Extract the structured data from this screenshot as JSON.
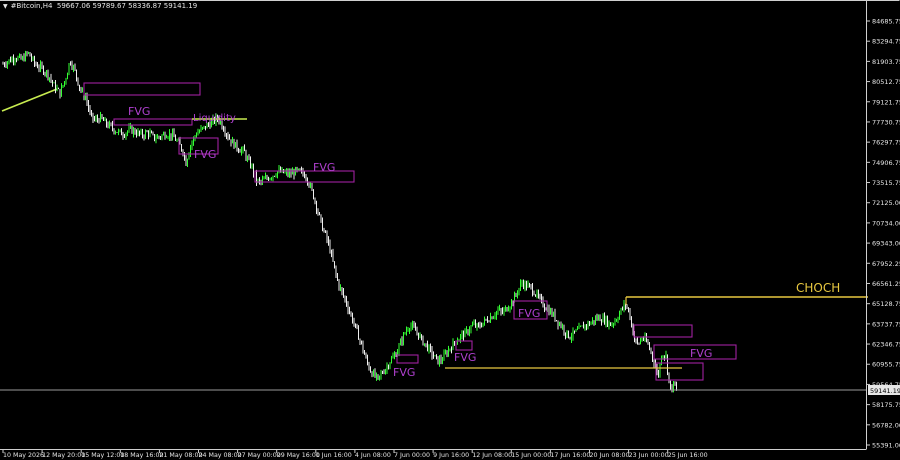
{
  "window": {
    "symbol": "#Bitcoin,H4",
    "ohlc": "59667.06 59789.67 58336.87 59141.19"
  },
  "colors": {
    "background": "#000000",
    "bull_candle": "#33ff33",
    "bear_candle": "#f0f0f0",
    "fvg_box": "#a020a0",
    "fvg_text": "#b040d0",
    "choch": "#e8c840",
    "liquidity": "#c8ec50",
    "trendline": "#c8ec50",
    "bid_line": "#9a9a9a",
    "axis_text": "#e6e6e6"
  },
  "chart_data": {
    "type": "candlestick",
    "price_axis": {
      "ticks": [
        "84685.75",
        "83294.75",
        "81903.75",
        "80512.75",
        "79121.75",
        "77730.75",
        "76297.75",
        "74906.75",
        "73515.75",
        "72125.00",
        "70734.00",
        "69343.00",
        "67952.25",
        "66561.25",
        "65128.75",
        "63737.75",
        "62346.75",
        "60955.75",
        "59564.75",
        "58175.75",
        "56782.00",
        "55391.00"
      ],
      "current_price": "59141.19"
    },
    "time_axis": {
      "ticks": [
        "10 May 2026",
        "12 May 20:00",
        "15 May 12:00",
        "18 May 16:00",
        "21 May 08:00",
        "24 May 08:00",
        "27 May 00:00",
        "29 May 16:00",
        "1 Jun 16:00",
        "4 Jun 08:00",
        "7 Jun 00:00",
        "9 Jun 16:00",
        "12 Jun 08:00",
        "15 Jun 00:00",
        "17 Jun 16:00",
        "20 Jun 08:00",
        "23 Jun 00:00",
        "25 Jun 16:00"
      ]
    },
    "close_path": [
      [
        0,
        81600
      ],
      [
        8,
        81900
      ],
      [
        15,
        82200
      ],
      [
        22,
        82000
      ],
      [
        28,
        82500
      ],
      [
        35,
        81700
      ],
      [
        42,
        81400
      ],
      [
        48,
        81000
      ],
      [
        54,
        80200
      ],
      [
        60,
        79700
      ],
      [
        66,
        80800
      ],
      [
        70,
        82000
      ],
      [
        75,
        81200
      ],
      [
        80,
        80000
      ],
      [
        86,
        79400
      ],
      [
        90,
        78200
      ],
      [
        95,
        77800
      ],
      [
        100,
        78000
      ],
      [
        106,
        77600
      ],
      [
        112,
        77300
      ],
      [
        118,
        77000
      ],
      [
        124,
        76900
      ],
      [
        130,
        77200
      ],
      [
        136,
        77000
      ],
      [
        142,
        76800
      ],
      [
        148,
        77000
      ],
      [
        154,
        76600
      ],
      [
        160,
        76700
      ],
      [
        166,
        76900
      ],
      [
        172,
        76800
      ],
      [
        178,
        76300
      ],
      [
        183,
        75700
      ],
      [
        186,
        74900
      ],
      [
        190,
        76000
      ],
      [
        196,
        76900
      ],
      [
        202,
        77200
      ],
      [
        208,
        77500
      ],
      [
        214,
        77800
      ],
      [
        218,
        78000
      ],
      [
        222,
        77500
      ],
      [
        226,
        77000
      ],
      [
        230,
        76500
      ],
      [
        235,
        76100
      ],
      [
        240,
        75800
      ],
      [
        244,
        75700
      ],
      [
        248,
        75000
      ],
      [
        252,
        74600
      ],
      [
        256,
        73700
      ],
      [
        260,
        73500
      ],
      [
        266,
        73800
      ],
      [
        272,
        74000
      ],
      [
        278,
        74300
      ],
      [
        284,
        74200
      ],
      [
        290,
        74100
      ],
      [
        296,
        74300
      ],
      [
        302,
        74200
      ],
      [
        306,
        74000
      ],
      [
        310,
        73300
      ],
      [
        314,
        72500
      ],
      [
        318,
        71500
      ],
      [
        322,
        70500
      ],
      [
        326,
        69800
      ],
      [
        330,
        68900
      ],
      [
        334,
        67700
      ],
      [
        338,
        66600
      ],
      [
        342,
        65900
      ],
      [
        346,
        65300
      ],
      [
        350,
        64500
      ],
      [
        354,
        63800
      ],
      [
        358,
        63000
      ],
      [
        362,
        62200
      ],
      [
        366,
        61300
      ],
      [
        370,
        60600
      ],
      [
        374,
        60200
      ],
      [
        378,
        59900
      ],
      [
        382,
        60400
      ],
      [
        386,
        60700
      ],
      [
        390,
        61200
      ],
      [
        394,
        61500
      ],
      [
        398,
        62000
      ],
      [
        402,
        62700
      ],
      [
        406,
        63300
      ],
      [
        410,
        63700
      ],
      [
        414,
        63400
      ],
      [
        418,
        63100
      ],
      [
        422,
        62600
      ],
      [
        426,
        62300
      ],
      [
        430,
        61900
      ],
      [
        434,
        61500
      ],
      [
        438,
        61200
      ],
      [
        442,
        61300
      ],
      [
        446,
        61700
      ],
      [
        450,
        62100
      ],
      [
        454,
        62400
      ],
      [
        458,
        62700
      ],
      [
        462,
        63000
      ],
      [
        466,
        63100
      ],
      [
        470,
        63500
      ],
      [
        474,
        63700
      ],
      [
        478,
        63500
      ],
      [
        482,
        63800
      ],
      [
        486,
        64000
      ],
      [
        490,
        64200
      ],
      [
        494,
        64400
      ],
      [
        498,
        64700
      ],
      [
        502,
        64500
      ],
      [
        506,
        64800
      ],
      [
        510,
        65100
      ],
      [
        514,
        65500
      ],
      [
        518,
        66100
      ],
      [
        522,
        66600
      ],
      [
        526,
        66400
      ],
      [
        530,
        66300
      ],
      [
        534,
        66000
      ],
      [
        538,
        65600
      ],
      [
        542,
        65200
      ],
      [
        546,
        64900
      ],
      [
        550,
        64600
      ],
      [
        554,
        64300
      ],
      [
        558,
        63900
      ],
      [
        562,
        63600
      ],
      [
        566,
        63100
      ],
      [
        570,
        62900
      ],
      [
        574,
        63100
      ],
      [
        578,
        63300
      ],
      [
        582,
        63500
      ],
      [
        586,
        63700
      ],
      [
        590,
        63800
      ],
      [
        594,
        64000
      ],
      [
        598,
        64200
      ],
      [
        602,
        64100
      ],
      [
        606,
        64000
      ],
      [
        610,
        63700
      ],
      [
        614,
        63900
      ],
      [
        618,
        64300
      ],
      [
        622,
        64800
      ],
      [
        626,
        65100
      ],
      [
        630,
        64300
      ],
      [
        634,
        62800
      ],
      [
        638,
        62300
      ],
      [
        642,
        62800
      ],
      [
        646,
        62600
      ],
      [
        650,
        62000
      ],
      [
        654,
        61200
      ],
      [
        658,
        60100
      ],
      [
        662,
        61800
      ],
      [
        666,
        61500
      ],
      [
        670,
        59200
      ],
      [
        674,
        59600
      ],
      [
        677,
        59141
      ]
    ]
  },
  "annotations": {
    "fvg_labels": [
      "FVG",
      "FVG",
      "FVG",
      "FVG",
      "FVG",
      "FVG",
      "FVG"
    ],
    "choch_label": "CHOCH",
    "liquidity_label": "Liquidity"
  }
}
